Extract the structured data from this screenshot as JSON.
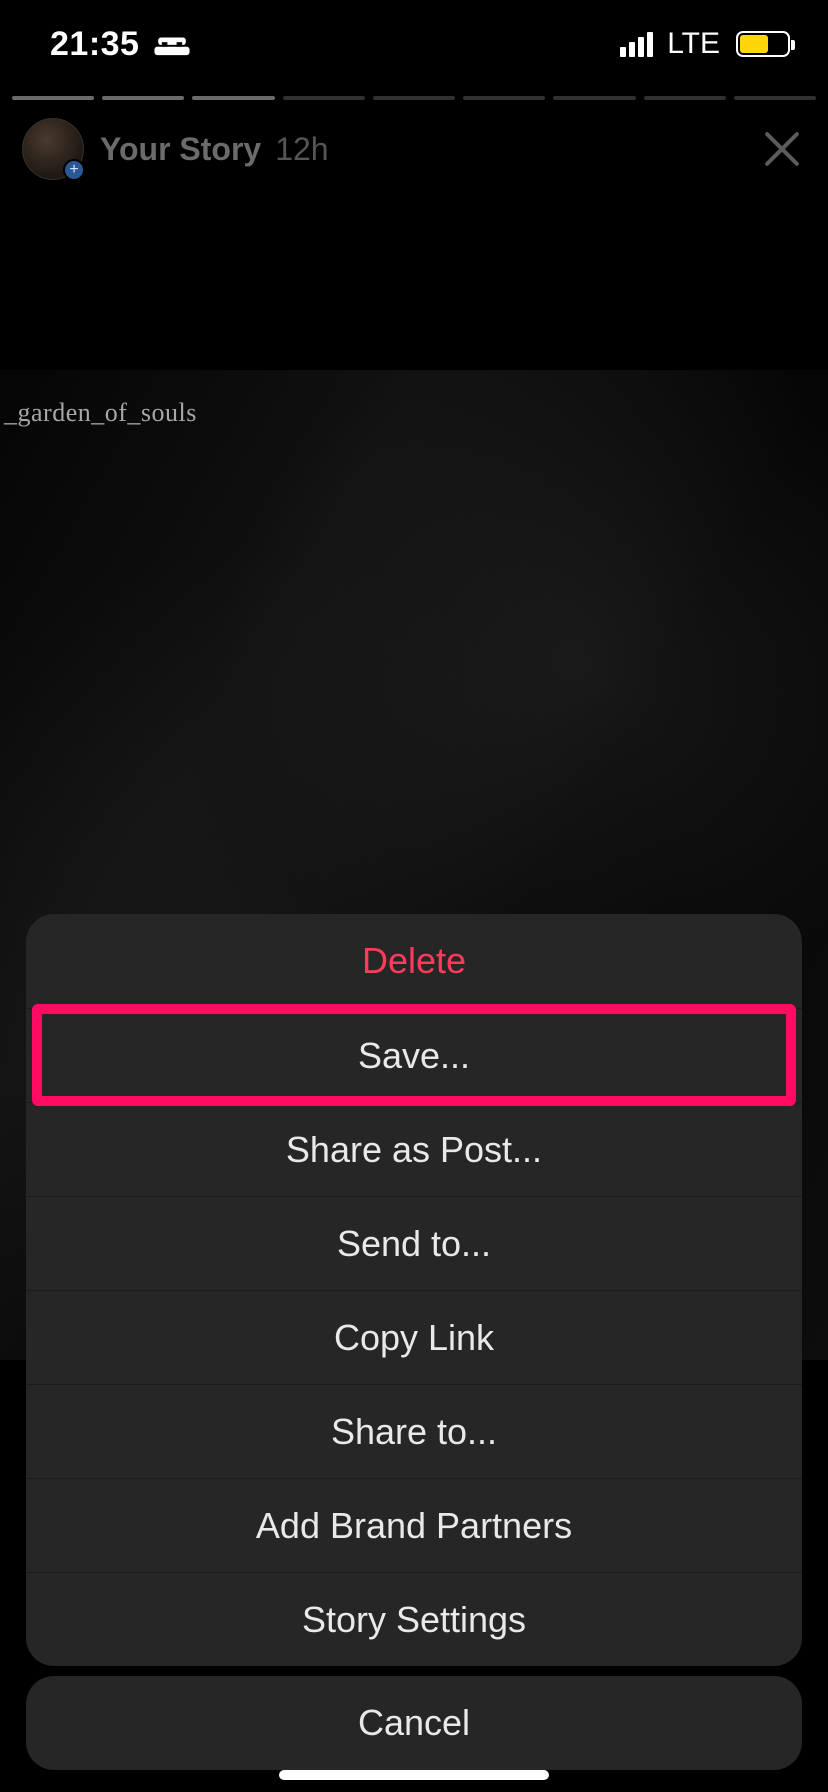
{
  "status": {
    "time": "21:35",
    "carrier_label": "LTE"
  },
  "story": {
    "owner_label": "Your Story",
    "age": "12h",
    "watermark": "_garden_of_souls",
    "segments": 9,
    "segments_filled": 3
  },
  "actions": {
    "delete": "Delete",
    "save": "Save...",
    "share_as_post": "Share as Post...",
    "send_to": "Send to...",
    "copy_link": "Copy Link",
    "share_to": "Share to...",
    "add_brand_partners": "Add Brand Partners",
    "story_settings": "Story Settings",
    "cancel": "Cancel"
  },
  "highlighted_action": "save"
}
